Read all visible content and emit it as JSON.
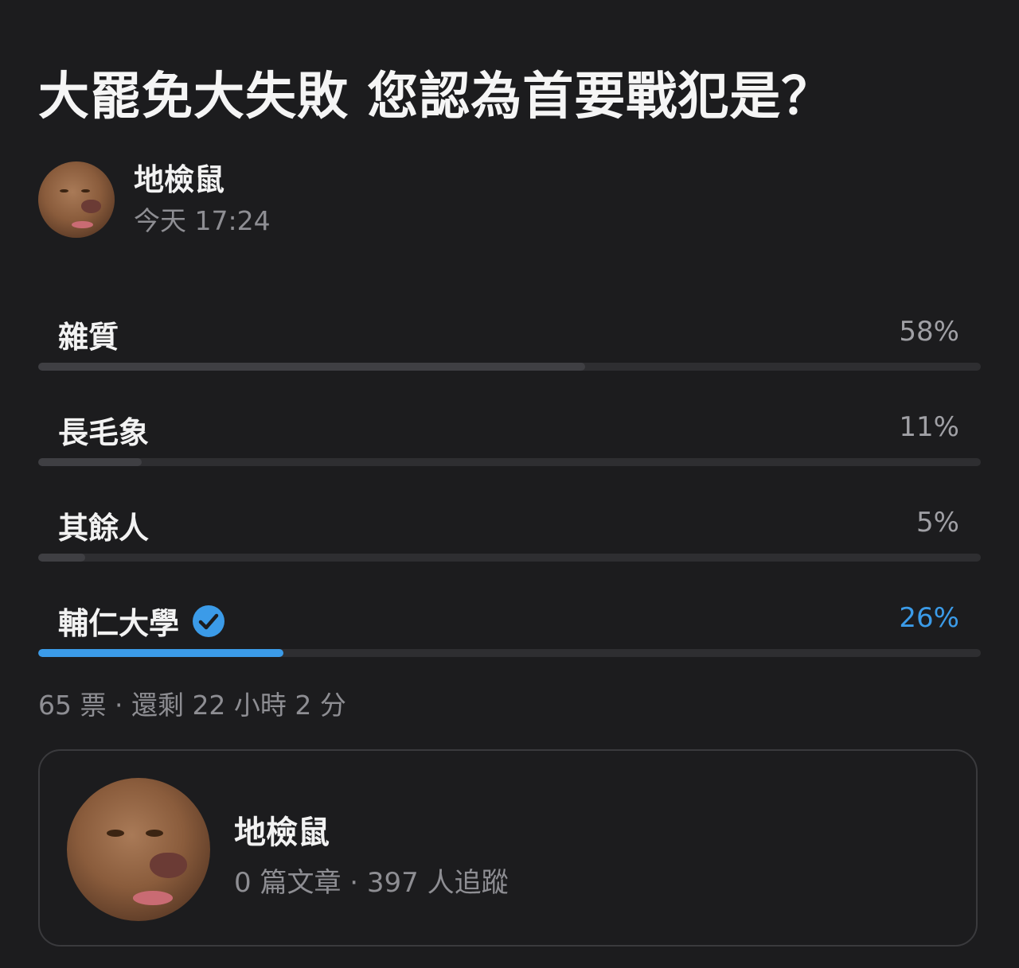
{
  "poll": {
    "title": "大罷免大失敗 您認為首要戰犯是？",
    "author": {
      "name": "地檢鼠",
      "time": "今天 17:24"
    },
    "options": [
      {
        "label": "雜質",
        "percent_label": "58%",
        "percent": 58,
        "selected": false
      },
      {
        "label": "長毛象",
        "percent_label": "11%",
        "percent": 11,
        "selected": false
      },
      {
        "label": "其餘人",
        "percent_label": "5%",
        "percent": 5,
        "selected": false
      },
      {
        "label": "輔仁大學",
        "percent_label": "26%",
        "percent": 26,
        "selected": true
      }
    ],
    "meta": "65 票 · 還剩 22 小時 2 分"
  },
  "profile_card": {
    "name": "地檢鼠",
    "stats": "0 篇文章 · 397 人追蹤"
  },
  "colors": {
    "background": "#1c1c1e",
    "accent": "#3b9be8",
    "bar_fill": "#3f3f43",
    "bar_track": "#2e2e31"
  },
  "icons": {
    "selected_indicator": "check-circle-icon"
  }
}
